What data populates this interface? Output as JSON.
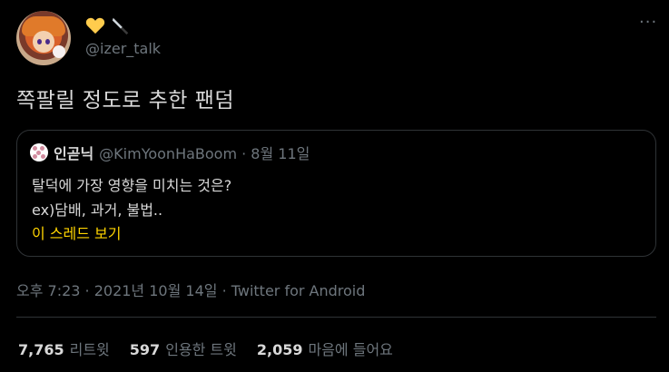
{
  "tweet": {
    "handle": "@izer_talk",
    "text": "쪽팔릴 정도로 추한 팬덤",
    "timestamp": "오후 7:23 · 2021년 10월 14일 · ",
    "source": "Twitter for Android"
  },
  "quote": {
    "name": "인곧닉",
    "meta": "@KimYoonHaBoom · 8월 11일",
    "line1": "탈덕에 가장 영향을 미치는 것은?",
    "line2": "ex)담배, 과거, 불법..",
    "thread_link": "이 스레드 보기"
  },
  "stats": [
    {
      "count": "7,765",
      "label": "리트윗"
    },
    {
      "count": "597",
      "label": "인용한 트윗"
    },
    {
      "count": "2,059",
      "label": "마음에 들어요"
    }
  ],
  "icons": {
    "heart_color": "#ffcc4d",
    "accent_link": "#ffd400"
  }
}
